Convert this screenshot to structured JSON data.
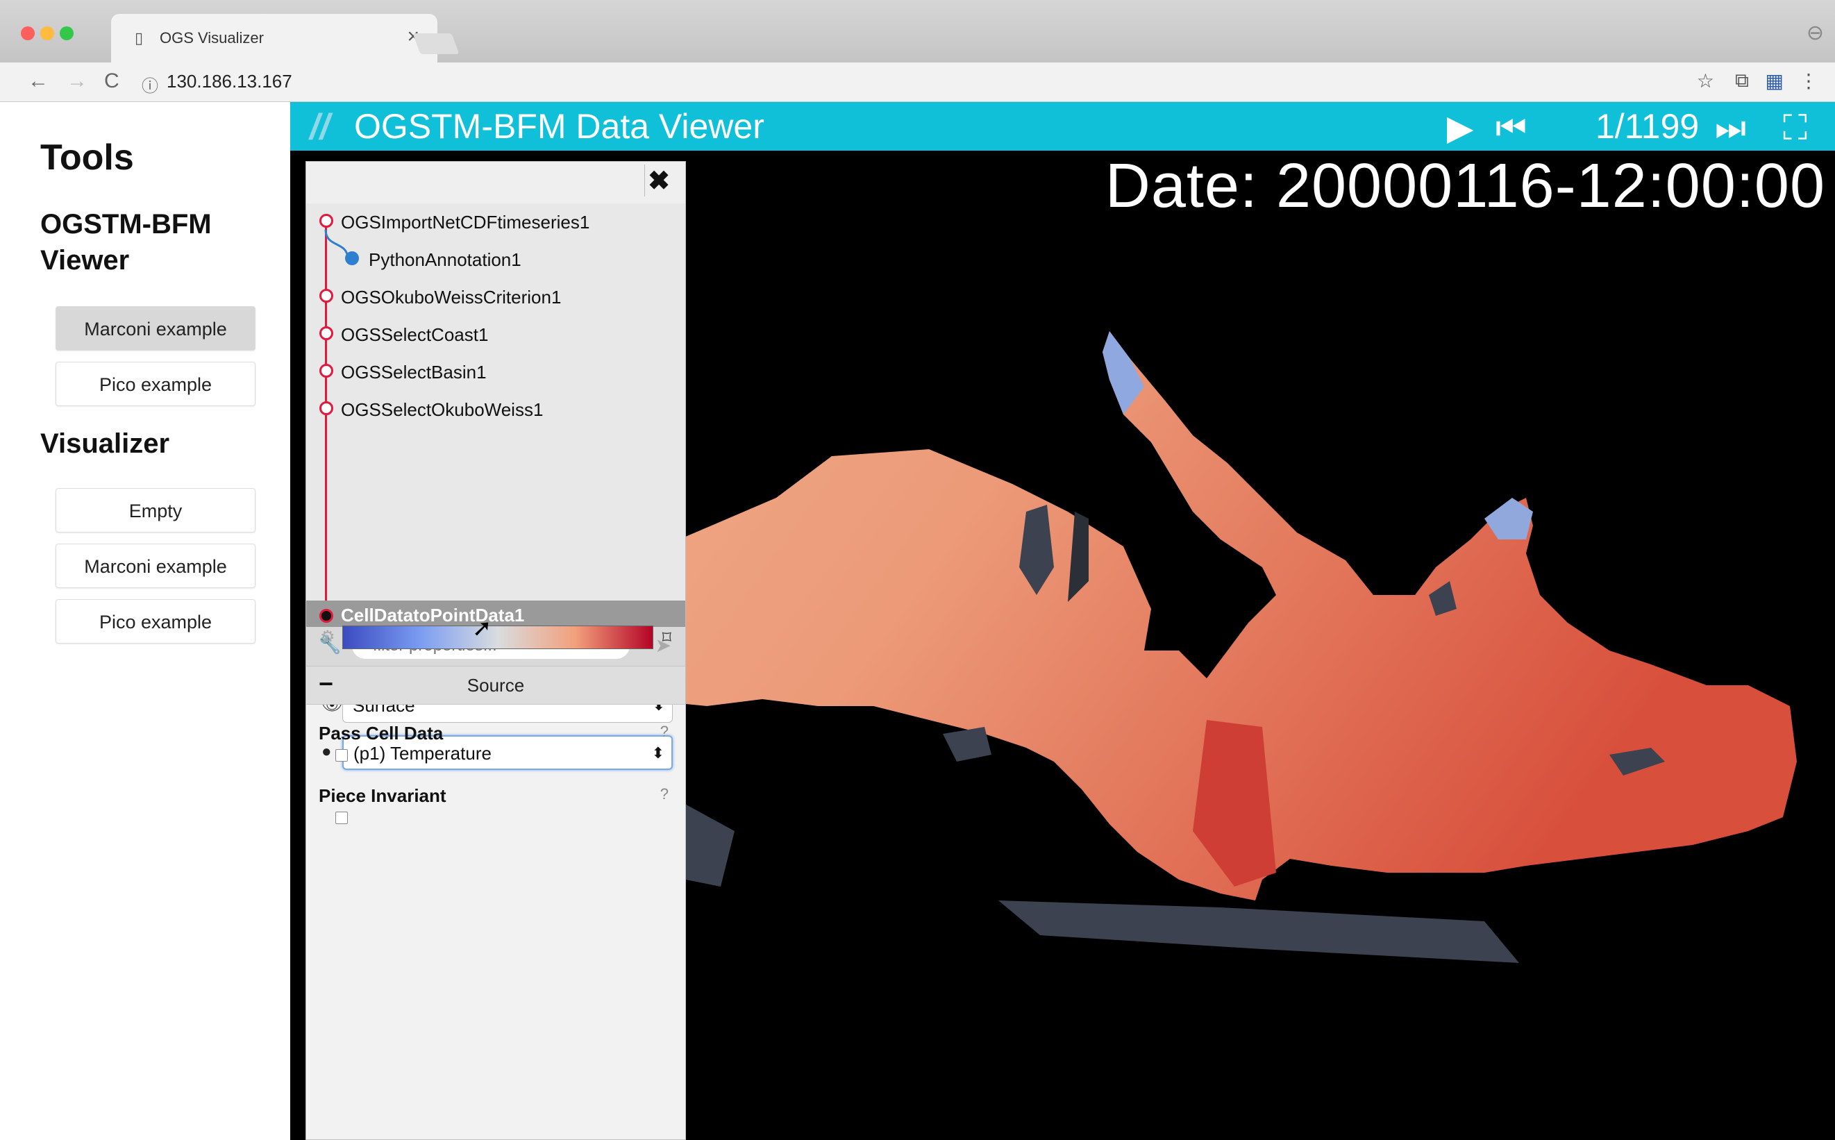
{
  "browser": {
    "tab_title": "OGS Visualizer",
    "tab_favicon": "▯",
    "tab_close": "×",
    "url_prefix_icon": "ⓘ",
    "url": "130.186.13.167",
    "nav": {
      "back": "←",
      "forward": "→",
      "reload": "C"
    },
    "addr_icons": {
      "star": "☆",
      "cast": "⧉",
      "extension": "▦",
      "menu": "⋮"
    },
    "profile_icon": "⊖"
  },
  "tools": {
    "title": "Tools",
    "section_title": "OGSTM-BFM Viewer",
    "section_buttons": [
      "Marconi example",
      "Pico example"
    ],
    "visualizer_title": "Visualizer",
    "visualizer_buttons": [
      "Empty",
      "Marconi example",
      "Pico example"
    ]
  },
  "viewer": {
    "logo": "//",
    "title": "OGSTM-BFM Data Viewer",
    "play": "▶",
    "first": "⏮",
    "frame": "1/1199",
    "last": "⏭",
    "fullscreen": "⛶",
    "date": "Date: 20000116-12:00:00"
  },
  "panel": {
    "close_icon": "✖",
    "pipeline": [
      {
        "label": "OGSImportNetCDFtimeseries1"
      },
      {
        "label": "PythonAnnotation1"
      },
      {
        "label": "OGSOkuboWeissCriterion1"
      },
      {
        "label": "OGSSelectCoast1"
      },
      {
        "label": "OGSSelectBasin1"
      },
      {
        "label": "OGSSelectOkuboWeiss1"
      },
      {
        "label": "CellDatatoPointData1"
      }
    ],
    "filter_placeholder": "filter properties...",
    "representation": "Surface",
    "color_by": "(p1) Temperature",
    "source_label": "Source",
    "properties": [
      {
        "label": "Pass Cell Data",
        "checked": false
      },
      {
        "label": "Piece Invariant",
        "checked": false
      }
    ]
  },
  "colors": {
    "header": "#10bfd8",
    "pipeline_line": "#e2183c",
    "child_node": "#2f7fd1"
  }
}
